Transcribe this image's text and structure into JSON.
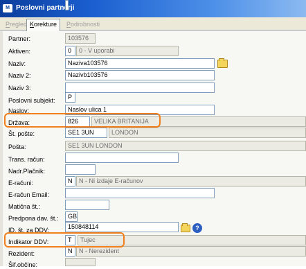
{
  "window": {
    "title": "Poslovni partnerji",
    "app_icon": "app-logo-icon"
  },
  "tabs": [
    {
      "label": "Pregled",
      "state": "disabled"
    },
    {
      "label": "Korekture",
      "state": "active"
    },
    {
      "label": "Podrobnosti",
      "state": "disabled"
    }
  ],
  "fields": {
    "partner": {
      "label": "Partner:",
      "value": "103576"
    },
    "aktiven": {
      "label": "Aktiven:",
      "code": "0",
      "desc": "0 - V uporabi"
    },
    "naziv": {
      "label": "Naziv:",
      "value": "Naziva103576"
    },
    "naziv2": {
      "label": "Naziv 2:",
      "value": "Nazivb103576"
    },
    "naziv3": {
      "label": "Naziv 3:",
      "value": ""
    },
    "poslovni_subjekt": {
      "label": "Poslovni subjekt:",
      "value": "P"
    },
    "naslov": {
      "label": "Naslov:",
      "value": "Naslov ulica 1"
    },
    "drzava": {
      "label": "Država:",
      "code": "826",
      "desc": "VELIKA BRITANIJA"
    },
    "st_poste": {
      "label": "Št. pošte:",
      "code": "SE1 3UN",
      "desc": "LONDON"
    },
    "posta": {
      "label": "Pošta:",
      "value": "SE1 3UN LONDON"
    },
    "trans_racun": {
      "label": "Trans. račun:",
      "value": ""
    },
    "nadr_placnik": {
      "label": "Nadr.Plačnik:",
      "value": ""
    },
    "e_racuni": {
      "label": "E-računi:",
      "code": "N",
      "desc": "N - Ni izdaje E-računov"
    },
    "e_racun_email": {
      "label": "E-račun Email:",
      "value": ""
    },
    "maticna_st": {
      "label": "Matična št.:",
      "value": ""
    },
    "predpona_dav": {
      "label": "Predpona dav. št.:",
      "value": "GB"
    },
    "id_st_ddv": {
      "label": "ID. št. za DDV:",
      "value": "150848114"
    },
    "indikator_ddv": {
      "label": "Indikator DDV:",
      "code": "T",
      "desc": "Tujec"
    },
    "rezident": {
      "label": "Rezident:",
      "code": "N",
      "desc": "N - Nerezident"
    },
    "sif_obcine": {
      "label": "Šif.občine:",
      "value": ""
    }
  },
  "highlights": {
    "color": "#f07f1c",
    "items": [
      "drzava",
      "indikator_ddv"
    ]
  },
  "icons": {
    "lookup": "folder-open-icon",
    "help": "help-icon"
  },
  "colors": {
    "titlebar_start": "#0b3e9c",
    "titlebar_end": "#8cbaf0",
    "highlight": "#f07f1c"
  }
}
